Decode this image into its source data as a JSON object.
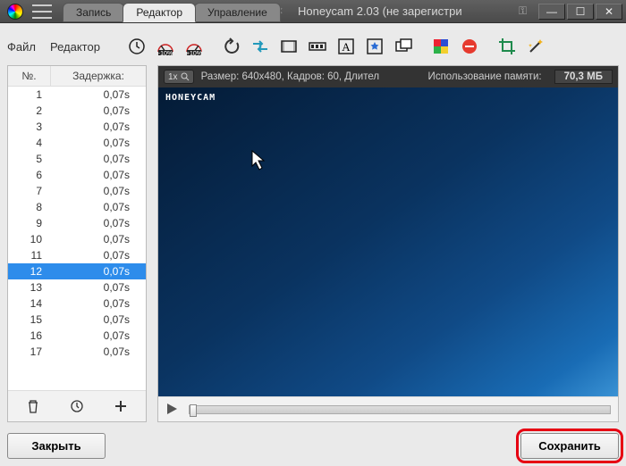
{
  "titlebar": {
    "tabs": [
      {
        "label": "Запись",
        "active": false
      },
      {
        "label": "Редактор",
        "active": true
      },
      {
        "label": "Управление",
        "active": false
      }
    ],
    "title": "Honeycam 2.03 (не зарегистри"
  },
  "menubar": {
    "file": "Файл",
    "editor": "Редактор"
  },
  "frames": {
    "col_no": "№.",
    "col_delay": "Задержка:",
    "rows": [
      {
        "n": 1,
        "d": "0,07s"
      },
      {
        "n": 2,
        "d": "0,07s"
      },
      {
        "n": 3,
        "d": "0,07s"
      },
      {
        "n": 4,
        "d": "0,07s"
      },
      {
        "n": 5,
        "d": "0,07s"
      },
      {
        "n": 6,
        "d": "0,07s"
      },
      {
        "n": 7,
        "d": "0,07s"
      },
      {
        "n": 8,
        "d": "0,07s"
      },
      {
        "n": 9,
        "d": "0,07s"
      },
      {
        "n": 10,
        "d": "0,07s"
      },
      {
        "n": 11,
        "d": "0,07s"
      },
      {
        "n": 12,
        "d": "0,07s",
        "selected": true
      },
      {
        "n": 13,
        "d": "0,07s"
      },
      {
        "n": 14,
        "d": "0,07s"
      },
      {
        "n": 15,
        "d": "0,07s"
      },
      {
        "n": 16,
        "d": "0,07s"
      },
      {
        "n": 17,
        "d": "0,07s"
      }
    ]
  },
  "infobar": {
    "zoom": "1x",
    "info": "Размер: 640x480, Кадров: 60, Длител",
    "mem_label": "Использование памяти:",
    "mem_value": "70,3 МБ"
  },
  "preview": {
    "watermark": "HONEYCAM"
  },
  "buttons": {
    "close": "Закрыть",
    "save": "Сохранить"
  }
}
